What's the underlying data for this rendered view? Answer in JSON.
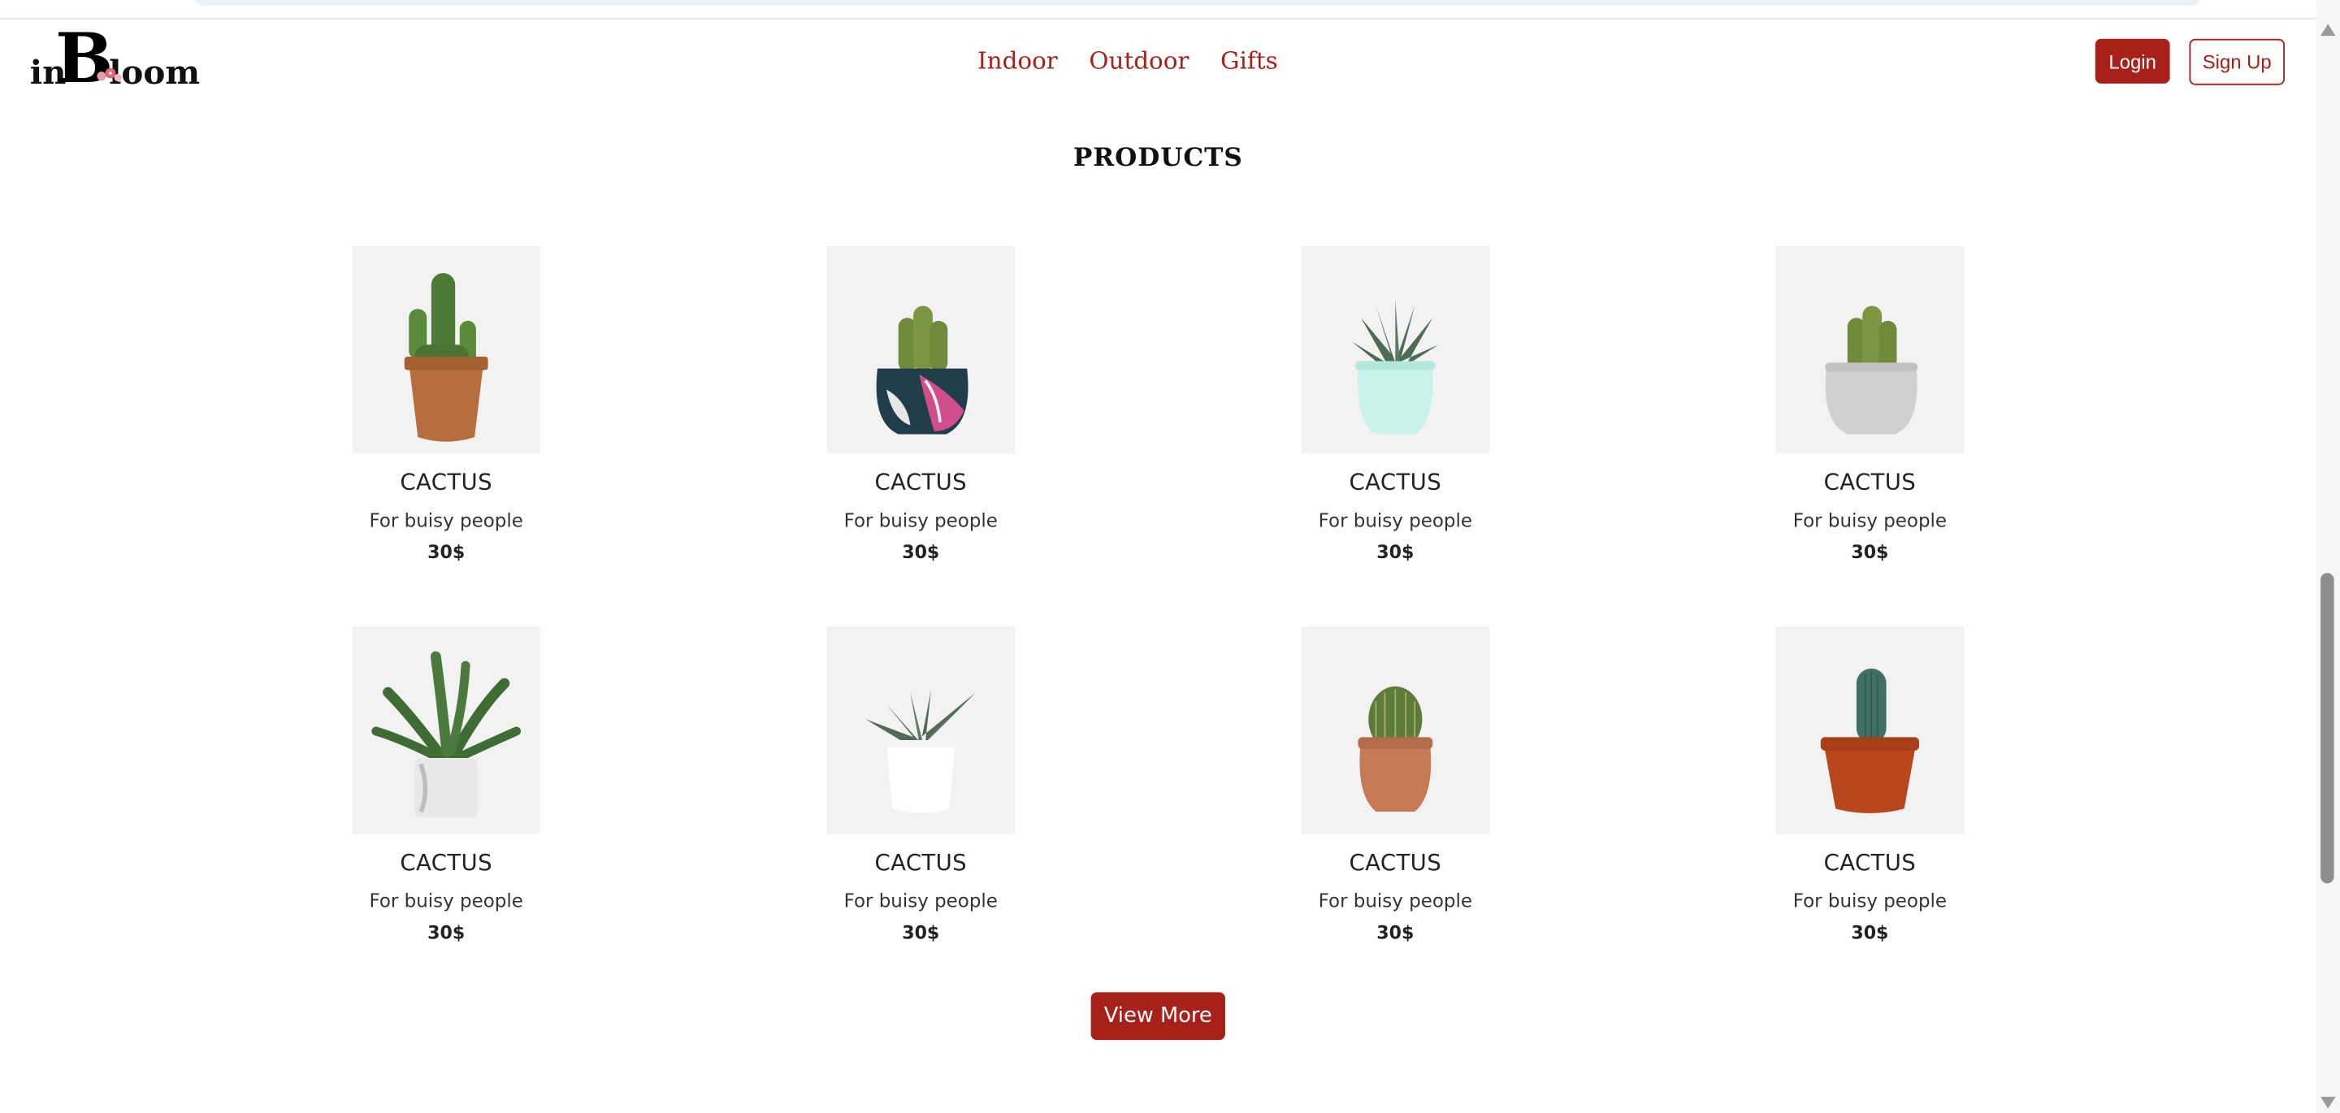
{
  "header": {
    "logo": {
      "text_small_left": "in",
      "text_big": "B",
      "text_small_right": "loom"
    },
    "nav": [
      {
        "label": "Indoor"
      },
      {
        "label": "Outdoor"
      },
      {
        "label": "Gifts"
      }
    ],
    "login_label": "Login",
    "signup_label": "Sign Up"
  },
  "main": {
    "section_title": "PRODUCTS",
    "products": [
      {
        "name": "CACTUS",
        "description": "For buisy people",
        "price": "30$",
        "plant": "cactus-tall",
        "pot": "terracotta"
      },
      {
        "name": "CACTUS",
        "description": "For buisy people",
        "price": "30$",
        "plant": "cactus-cluster",
        "pot": "patterned"
      },
      {
        "name": "CACTUS",
        "description": "For buisy people",
        "price": "30$",
        "plant": "agave",
        "pot": "mint"
      },
      {
        "name": "CACTUS",
        "description": "For buisy people",
        "price": "30$",
        "plant": "cactus-cluster",
        "pot": "grey"
      },
      {
        "name": "CACTUS",
        "description": "For buisy people",
        "price": "30$",
        "plant": "jade",
        "pot": "white-tall"
      },
      {
        "name": "CACTUS",
        "description": "For buisy people",
        "price": "30$",
        "plant": "haworthia",
        "pot": "white"
      },
      {
        "name": "CACTUS",
        "description": "For buisy people",
        "price": "30$",
        "plant": "barrel",
        "pot": "terracotta-round"
      },
      {
        "name": "CACTUS",
        "description": "For buisy people",
        "price": "30$",
        "plant": "column",
        "pot": "rust"
      }
    ],
    "view_more_label": "View More"
  },
  "colors": {
    "accent": "#a8201a",
    "card_bg": "#f2f2f2"
  }
}
